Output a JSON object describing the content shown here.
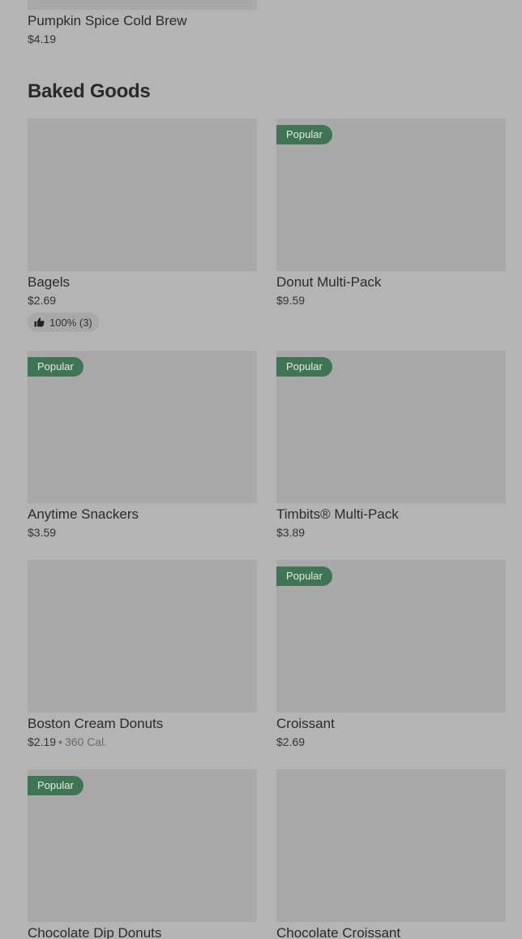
{
  "top_item": {
    "name": "Pumpkin Spice Cold Brew",
    "price": "$4.19"
  },
  "section": {
    "title": "Baked Goods"
  },
  "items": [
    {
      "name": "Bagels",
      "price": "$2.69",
      "rating": "100% (3)"
    },
    {
      "name": "Donut Multi-Pack",
      "price": "$9.59",
      "badge": "Popular"
    },
    {
      "name": "Anytime Snackers",
      "price": "$3.59",
      "badge": "Popular"
    },
    {
      "name": "Timbits® Multi-Pack",
      "price": "$3.89",
      "badge": "Popular"
    },
    {
      "name": "Boston Cream Donuts",
      "price": "$2.19",
      "calories": "360 Cal."
    },
    {
      "name": "Croissant",
      "price": "$2.69",
      "badge": "Popular"
    },
    {
      "name": "Chocolate Dip Donuts",
      "badge": "Popular"
    },
    {
      "name": "Chocolate Croissant"
    }
  ],
  "icons": {
    "rating": "thumbs-up-icon"
  },
  "colors": {
    "background": "#b4b4b4",
    "image_placeholder": "#a8a8a8",
    "badge": "#3f7455"
  }
}
